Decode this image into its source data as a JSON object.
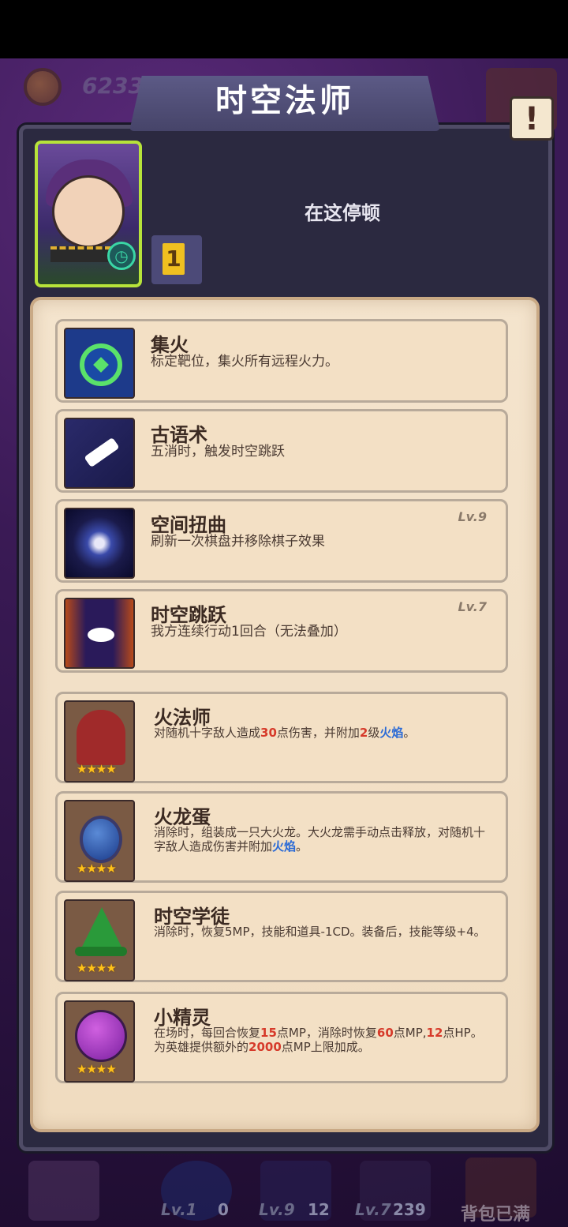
{
  "header": {
    "title": "时空法师",
    "coin_value": "6233",
    "alert_icon": "exclamation-icon"
  },
  "hero": {
    "status": "在这停顿",
    "rank": "1"
  },
  "skills": [
    {
      "name": "集火",
      "desc": "标定靶位，集火所有远程火力。",
      "level": ""
    },
    {
      "name": "古语术",
      "desc": "五消时，触发时空跳跃",
      "level": ""
    },
    {
      "name": "空间扭曲",
      "desc": "刷新一次棋盘并移除棋子效果",
      "level": "Lv.9"
    },
    {
      "name": "时空跳跃",
      "desc": "我方连续行动1回合（无法叠加）",
      "level": "Lv.7"
    }
  ],
  "units": [
    {
      "name": "火法师",
      "desc_parts": [
        {
          "text": "对随机十字敌人造成",
          "style": ""
        },
        {
          "text": "30",
          "style": "red"
        },
        {
          "text": "点伤害，并附加",
          "style": ""
        },
        {
          "text": "2",
          "style": "red"
        },
        {
          "text": "级",
          "style": ""
        },
        {
          "text": "火焰",
          "style": "blue"
        },
        {
          "text": "。",
          "style": ""
        }
      ],
      "stars": "★★★★"
    },
    {
      "name": "火龙蛋",
      "desc_parts": [
        {
          "text": "消除时，组装成一只大火龙。大火龙需手动点击释放，对随机十字敌人造成伤害并附加",
          "style": ""
        },
        {
          "text": "火焰",
          "style": "blue"
        },
        {
          "text": "。",
          "style": ""
        }
      ],
      "stars": "★★★★"
    },
    {
      "name": "时空学徒",
      "desc_parts": [
        {
          "text": "消除时，恢复5MP，技能和道具-1CD。装备后，技能等级+4。",
          "style": ""
        }
      ],
      "stars": "★★★★"
    },
    {
      "name": "小精灵",
      "desc_parts": [
        {
          "text": "在场时，每回合恢复",
          "style": ""
        },
        {
          "text": "15",
          "style": "red"
        },
        {
          "text": "点MP，消除时恢复",
          "style": ""
        },
        {
          "text": "60",
          "style": "red"
        },
        {
          "text": "点MP,",
          "style": ""
        },
        {
          "text": "12",
          "style": "red"
        },
        {
          "text": "点HP。为英雄提供额外的",
          "style": ""
        },
        {
          "text": "2000",
          "style": "red"
        },
        {
          "text": "点MP上限加成。",
          "style": ""
        }
      ],
      "stars": "★★★★"
    }
  ],
  "bottom_bar": {
    "items": [
      {
        "label": "",
        "count": ""
      },
      {
        "label": "Lv.1",
        "count": "0"
      },
      {
        "label": "Lv.9",
        "count": "12"
      },
      {
        "label": "Lv.7",
        "count": "239"
      }
    ],
    "bag_label": "背包已满"
  },
  "colors": {
    "highlight_red": "#d63a2a",
    "highlight_blue": "#2a6ad6",
    "parchment": "#f4e4cd",
    "frame": "#2b2940"
  }
}
